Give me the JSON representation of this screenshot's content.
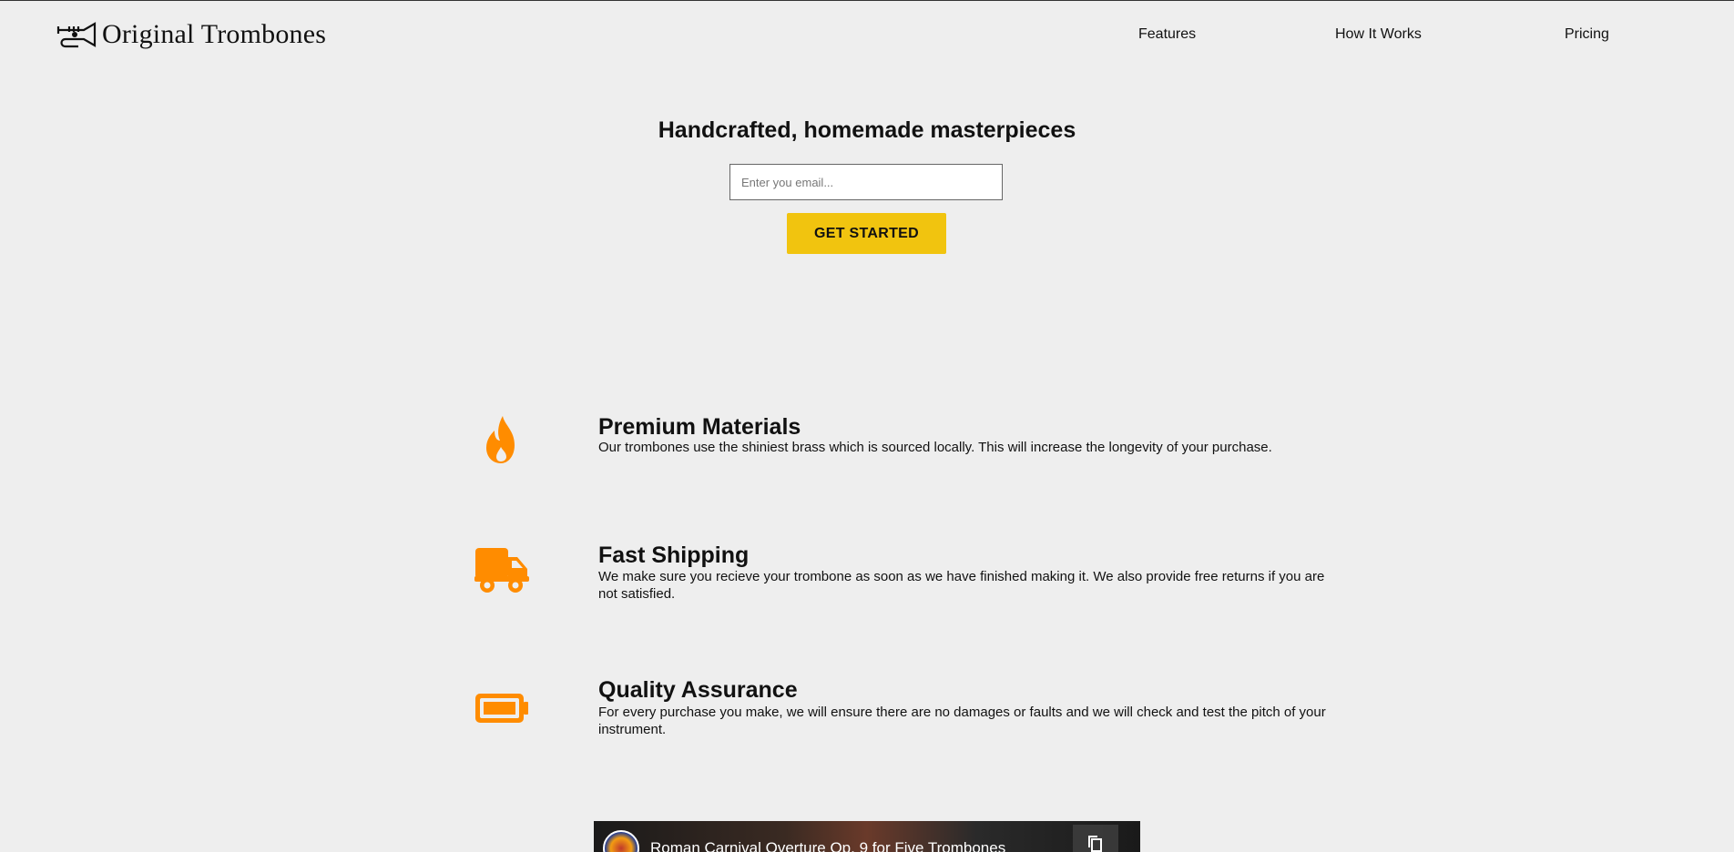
{
  "header": {
    "brand": "Original Trombones",
    "nav": [
      {
        "label": "Features"
      },
      {
        "label": "How It Works"
      },
      {
        "label": "Pricing"
      }
    ]
  },
  "hero": {
    "title": "Handcrafted, homemade masterpieces",
    "email_placeholder": "Enter you email...",
    "cta_label": "GET STARTED"
  },
  "features": [
    {
      "icon": "fire-icon",
      "title": "Premium Materials",
      "text": "Our trombones use the shiniest brass which is sourced locally. This will increase the longevity of your purchase."
    },
    {
      "icon": "truck-icon",
      "title": "Fast Shipping",
      "text": "We make sure you recieve your trombone as soon as we have finished making it. We also provide free returns if you are not satisfied."
    },
    {
      "icon": "battery-icon",
      "title": "Quality Assurance",
      "text": "For every purchase you make, we will ensure there are no damages or faults and we will check and test the pitch of your instrument."
    }
  ],
  "video": {
    "title": "Roman Carnival Overture Op. 9 for Five Trombones"
  },
  "colors": {
    "accent": "#f1c40f",
    "icon": "#ff8c00",
    "background": "#eeeeee"
  }
}
